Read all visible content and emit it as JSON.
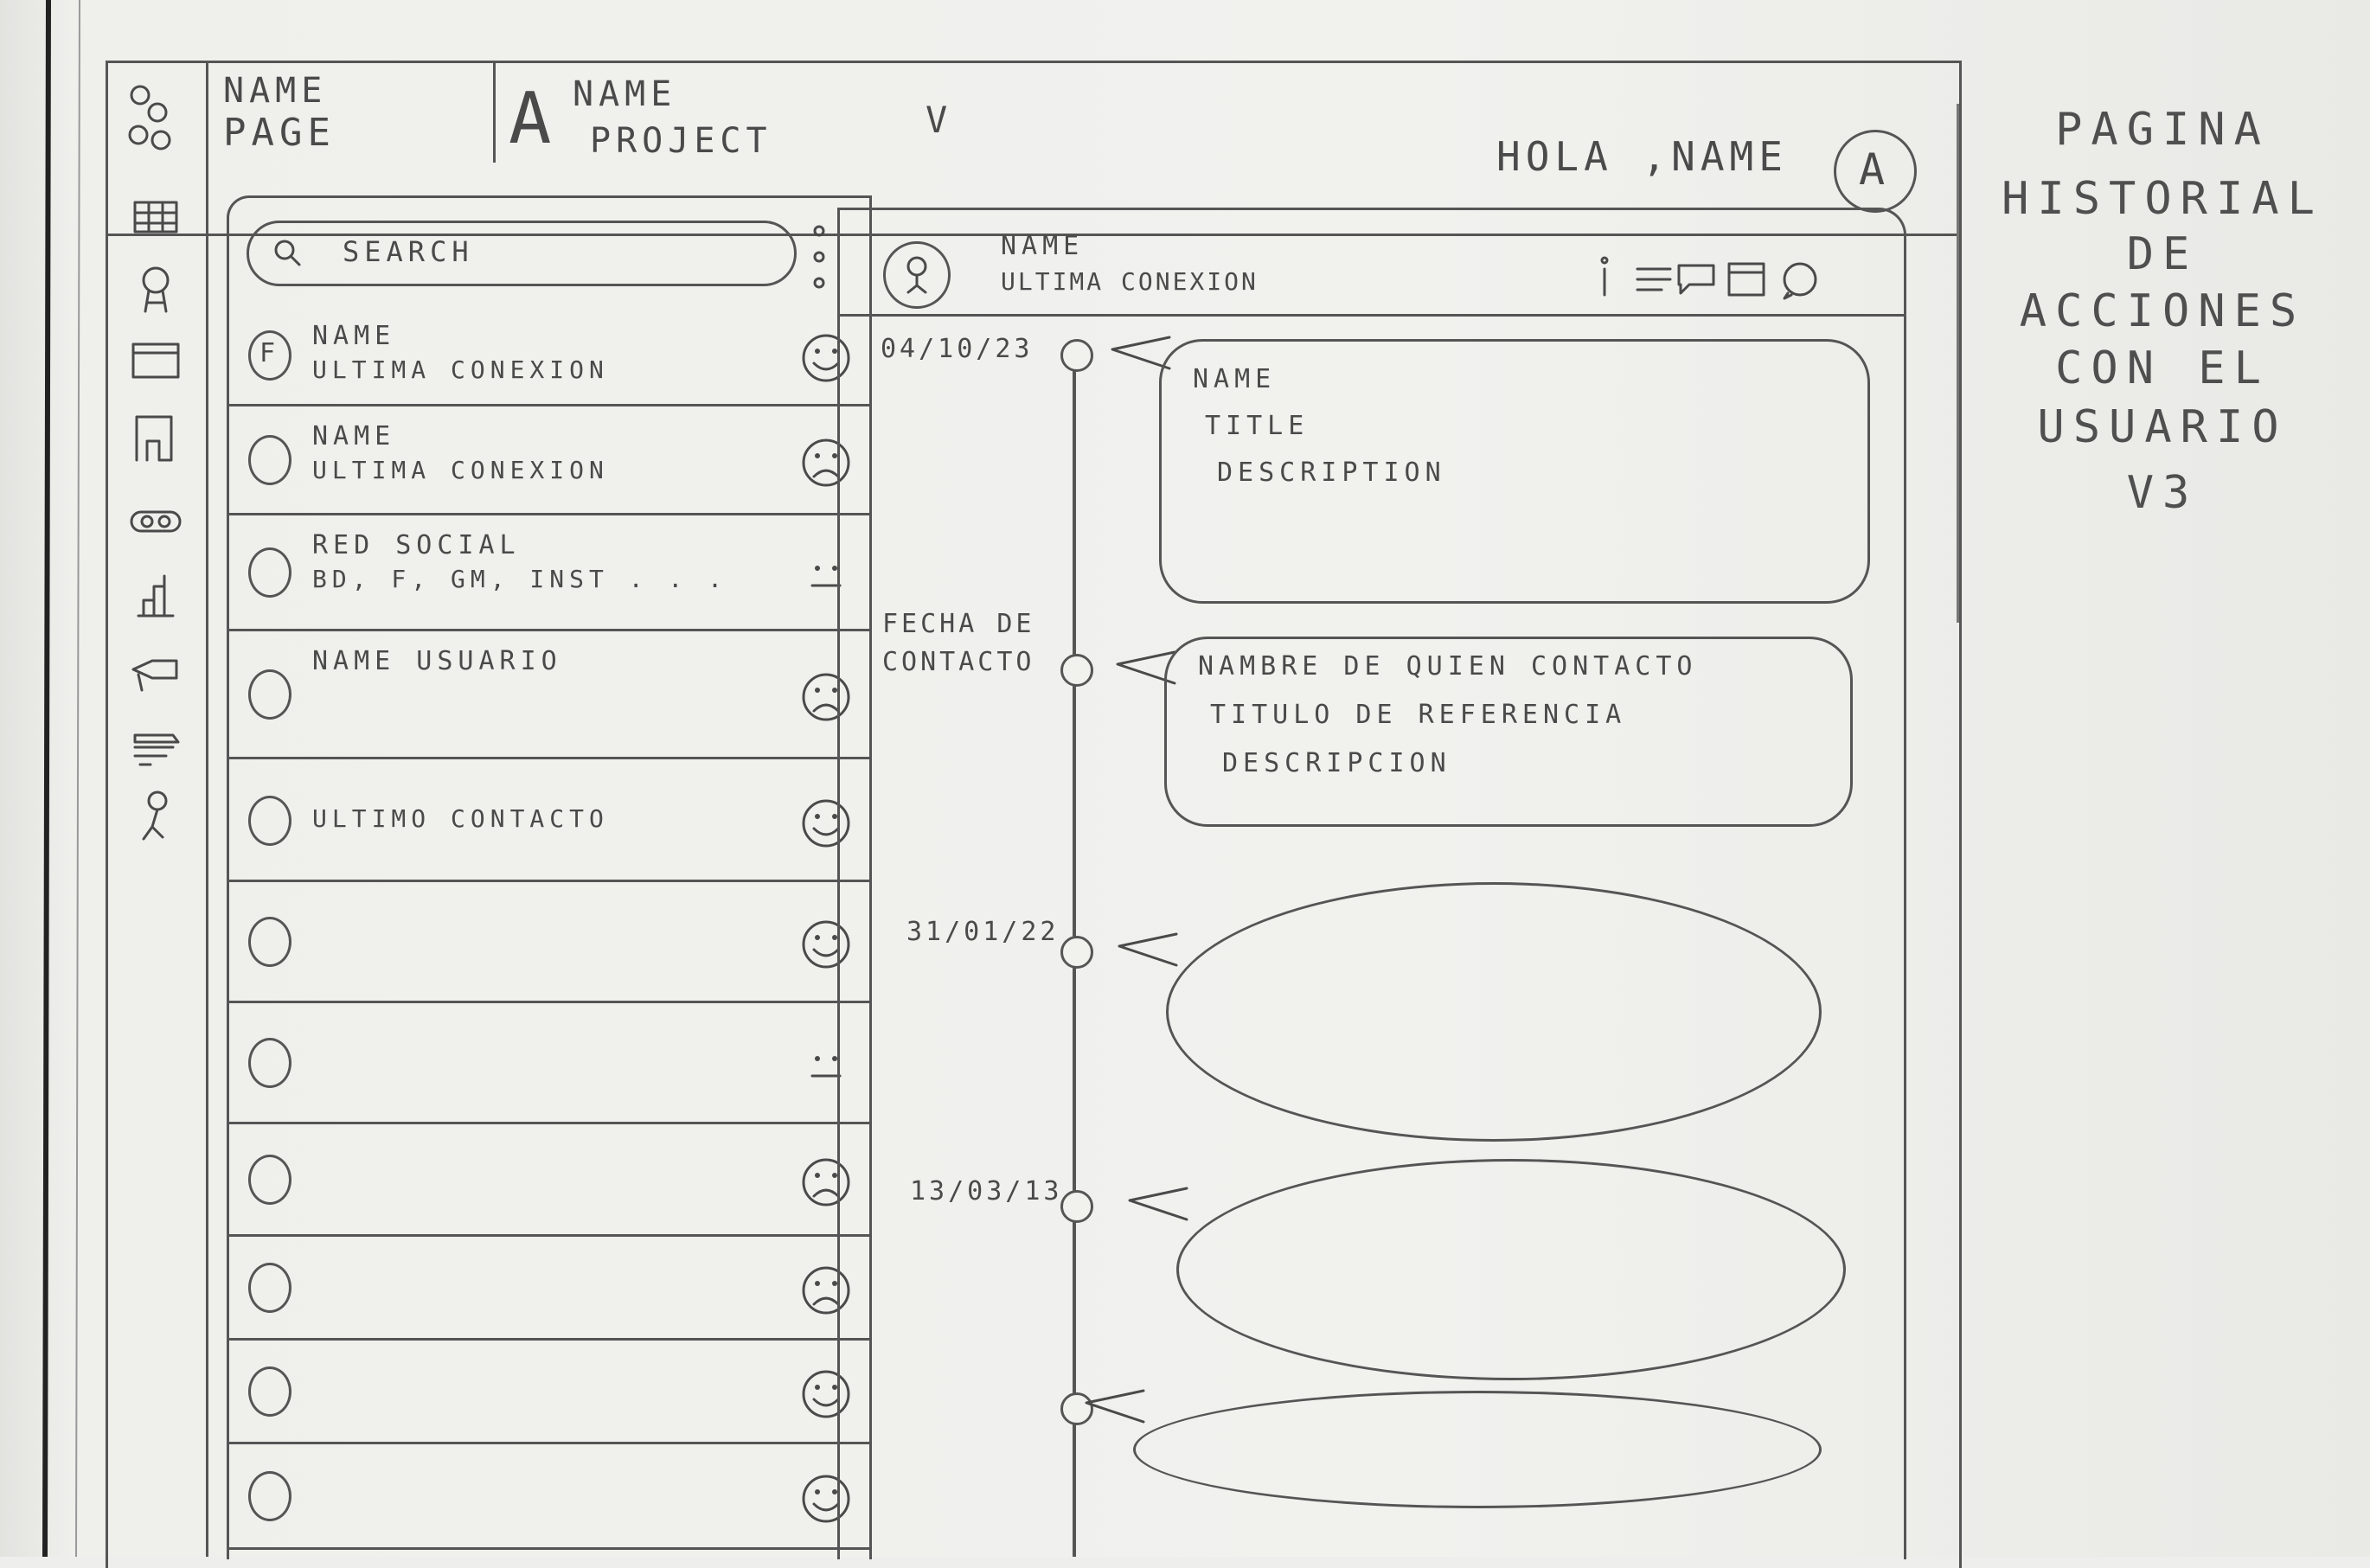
{
  "header": {
    "page_label_line1": "NAME",
    "page_label_line2": "PAGE",
    "project_letter": "A",
    "project_line1": "NAME",
    "project_line2": "PROJECT",
    "project_chevron": "V",
    "greeting": "HOLA ,NAME",
    "user_avatar_letter": "A"
  },
  "sidebar": {
    "icons": [
      "grid-icon",
      "pin-icon",
      "window-icon",
      "door-icon",
      "link-icon",
      "chart-icon",
      "megaphone-icon",
      "stack-icon",
      "person-icon"
    ]
  },
  "search": {
    "placeholder": "SEARCH"
  },
  "contacts": [
    {
      "avatar_letter": "F",
      "name": "NAME",
      "sub": "ULTIMA CONEXION",
      "mood": "happy"
    },
    {
      "avatar_letter": "",
      "name": "NAME",
      "sub": "ULTIMA CONEXION",
      "mood": "sad"
    },
    {
      "avatar_letter": "",
      "name": "RED SOCIAL",
      "sub": "BD, F, GM, Inst . . .",
      "mood": "neutral"
    },
    {
      "avatar_letter": "",
      "name": "NAME USUARIO",
      "sub": "",
      "mood": "sad"
    },
    {
      "avatar_letter": "",
      "name": "",
      "sub": "ULTIMO CONTACTO",
      "mood": "happy"
    },
    {
      "avatar_letter": "",
      "name": "",
      "sub": "",
      "mood": "happy"
    },
    {
      "avatar_letter": "",
      "name": "",
      "sub": "",
      "mood": "neutral"
    },
    {
      "avatar_letter": "",
      "name": "",
      "sub": "",
      "mood": "sad"
    },
    {
      "avatar_letter": "",
      "name": "",
      "sub": "",
      "mood": "sad"
    },
    {
      "avatar_letter": "",
      "name": "",
      "sub": "",
      "mood": "happy"
    },
    {
      "avatar_letter": "",
      "name": "",
      "sub": "",
      "mood": "happy"
    }
  ],
  "detail": {
    "name": "NAME",
    "sub": "ULTIMA CONEXION",
    "toolbar_icons": [
      "info-icon",
      "list-icon",
      "chat-icon",
      "calendar-icon",
      "whatsapp-icon"
    ]
  },
  "timeline": {
    "entries": [
      {
        "date": "04/10/23",
        "line1": "NAME",
        "line2": "TITLE",
        "line3": "DESCRIPTION"
      },
      {
        "date": "FECHA DE CONTACTO",
        "line1": "NAMBRE DE QUIEN CONTACTO",
        "line2": "TITULO DE REFERENCIA",
        "line3": "DESCRIPCION"
      },
      {
        "date": "31/01/22",
        "line1": "",
        "line2": "",
        "line3": ""
      },
      {
        "date": "13/03/13",
        "line1": "",
        "line2": "",
        "line3": ""
      },
      {
        "date": "",
        "line1": "",
        "line2": "",
        "line3": ""
      }
    ]
  },
  "side_note": {
    "line1": "PAGINA",
    "line2": "HISTORIAL",
    "line3": "DE",
    "line4": "ACCIONES",
    "line5": "CON EL",
    "line6": "USUARIO",
    "line7": "V3"
  }
}
